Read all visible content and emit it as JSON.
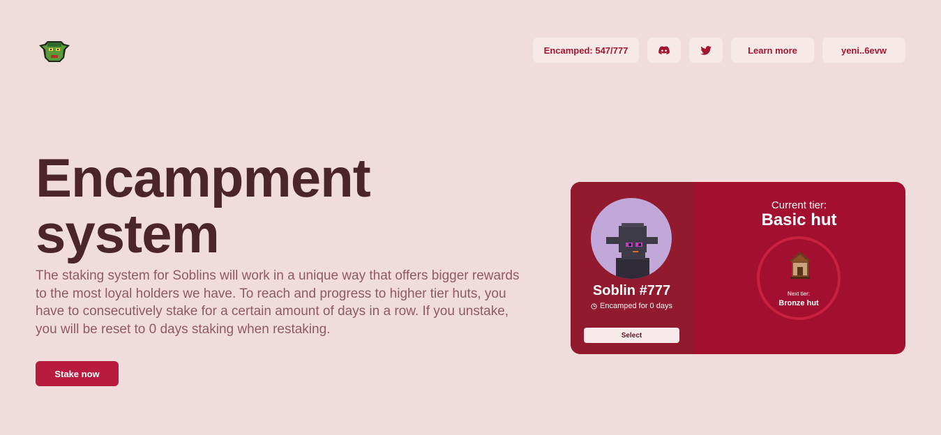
{
  "header": {
    "logo_icon": "goblin-logo-icon",
    "encamped": "Encamped: 547/777",
    "discord_icon": "discord-icon",
    "twitter_icon": "twitter-icon",
    "learn_more": "Learn more",
    "wallet": "yeni..6evw"
  },
  "hero": {
    "title_line1": "Encampment",
    "title_line2": "system",
    "description": "The staking system for Soblins will work in a unique way that offers bigger rewards to the most loyal holders we have. To reach and progress to higher tier huts, you have to consecutively stake for a certain amount of days in a row. If you unstake, you will be reset to 0 days staking when restaking.",
    "stake_button": "Stake now"
  },
  "card": {
    "soblin_name": "Soblin #777",
    "encamped_days": "Encamped for 0 days",
    "select_button": "Select",
    "current_tier_label": "Current tier:",
    "current_tier": "Basic hut",
    "next_tier_label": "Next tier:",
    "next_tier": "Bronze hut"
  },
  "colors": {
    "background": "#f1dcdc",
    "accent": "#b81b3d",
    "card": "#a3102f",
    "heading": "#4a262c"
  }
}
